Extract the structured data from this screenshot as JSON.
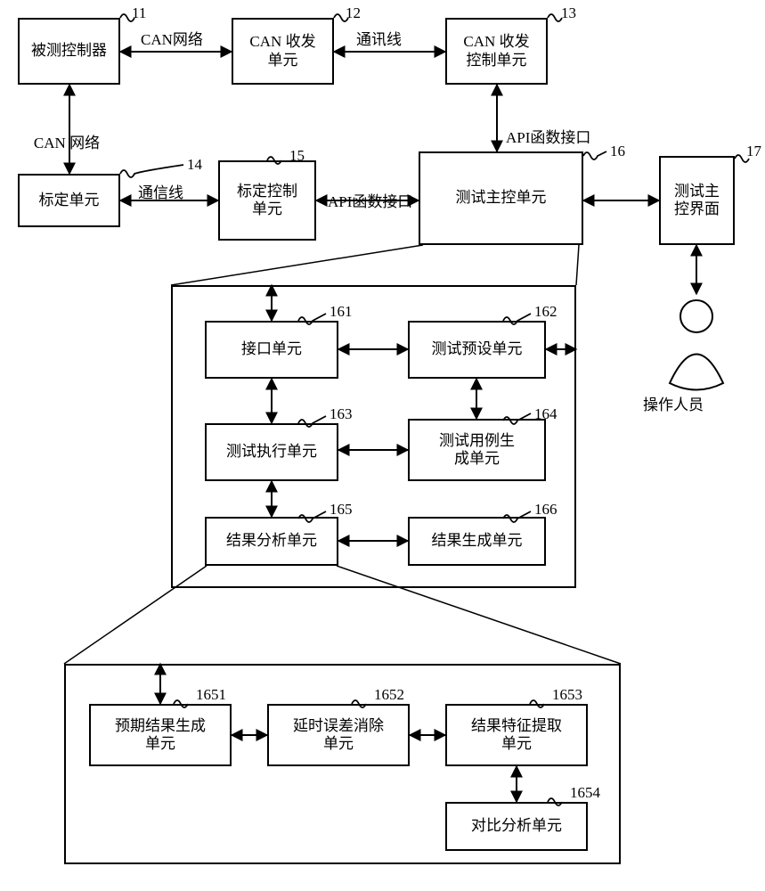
{
  "boxes": {
    "b11": "被测控制器",
    "b12": "CAN 收发\n单元",
    "b13": "CAN 收发\n控制单元",
    "b14": "标定单元",
    "b15": "标定控制\n单元",
    "b16": "测试主控单元",
    "b17": "测试主\n控界面",
    "b161": "接口单元",
    "b162": "测试预设单元",
    "b163": "测试执行单元",
    "b164": "测试用例生\n成单元",
    "b165": "结果分析单元",
    "b166": "结果生成单元",
    "b1651": "预期结果生成\n单元",
    "b1652": "延时误差消除\n单元",
    "b1653": "结果特征提取\n单元",
    "b1654": "对比分析单元"
  },
  "leads": {
    "l11": "11",
    "l12": "12",
    "l13": "13",
    "l14": "14",
    "l15": "15",
    "l16": "16",
    "l17": "17",
    "l161": "161",
    "l162": "162",
    "l163": "163",
    "l164": "164",
    "l165": "165",
    "l166": "166",
    "l1651": "1651",
    "l1652": "1652",
    "l1653": "1653",
    "l1654": "1654"
  },
  "edges": {
    "e1": "CAN网络",
    "e2": "通讯线",
    "e3": "CAN 网络",
    "e4": "通信线",
    "e5": "API函数接口",
    "e6": "API函数接口"
  },
  "misc": {
    "operator": "操作人员"
  }
}
